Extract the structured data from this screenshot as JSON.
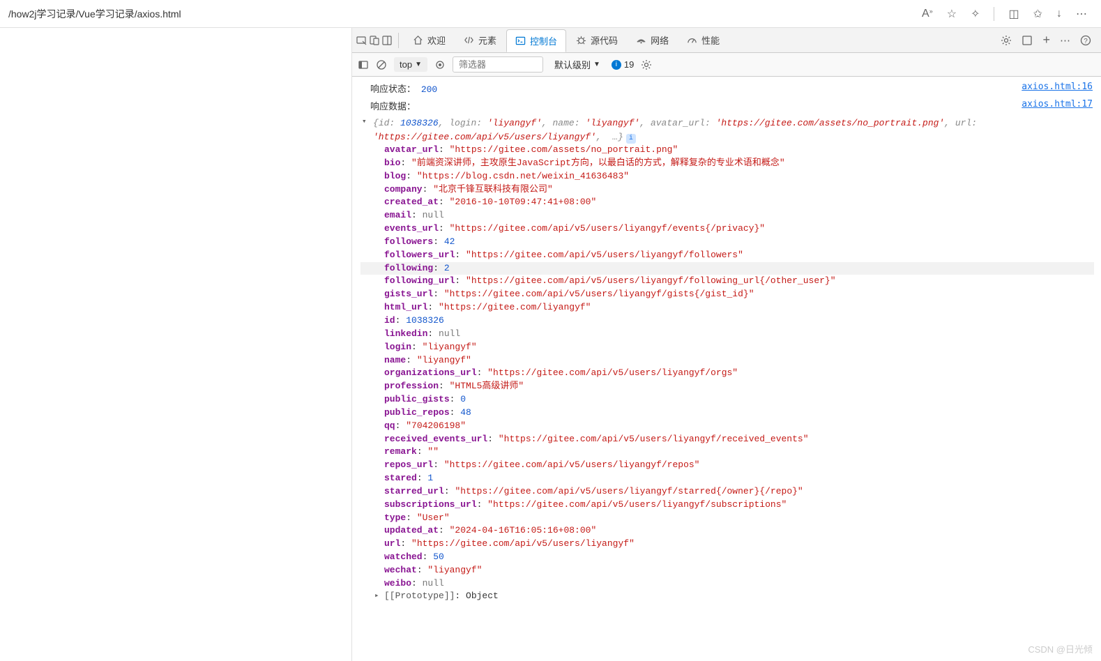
{
  "browser": {
    "url": "/how2j学习记录/Vue学习记录/axios.html"
  },
  "devtools": {
    "tabs": {
      "welcome": "欢迎",
      "elements": "元素",
      "console": "控制台",
      "sources": "源代码",
      "network": "网络",
      "performance": "性能"
    },
    "toolbar": {
      "context": "top",
      "filter_placeholder": "筛选器",
      "level": "默认级别",
      "issues_count": "19"
    }
  },
  "logs": {
    "status": {
      "label": "响应状态：",
      "value": "200",
      "src": "axios.html:16"
    },
    "data": {
      "label": "响应数据：",
      "src": "axios.html:17"
    },
    "summary": "{id: 1038326, login: 'liyangyf', name: 'liyangyf', avatar_url: 'https://gitee.com/assets/no_portrait.png', url: 'https://gitee.com/api/v5/users/liyangyf', …}",
    "summary_parts": {
      "id_k": "id:",
      "id_v": "1038326",
      "login_k": "login:",
      "login_v": "'liyangyf'",
      "name_k": "name:",
      "name_v": "'liyangyf'",
      "avatar_k": "avatar_url:",
      "avatar_v": "'https://gitee.com/assets/no_portrait.png'",
      "url_k": "url:",
      "url_v": "'https://gitee.com/api/v5/users/liyangyf'",
      "more": "…}"
    },
    "props": [
      {
        "key": "avatar_url",
        "type": "str",
        "val": "\"https://gitee.com/assets/no_portrait.png\""
      },
      {
        "key": "bio",
        "type": "str",
        "val": "\"前端资深讲师，主攻原生JavaScript方向，以最白话的方式，解释复杂的专业术语和概念\""
      },
      {
        "key": "blog",
        "type": "str",
        "val": "\"https://blog.csdn.net/weixin_41636483\""
      },
      {
        "key": "company",
        "type": "str",
        "val": "\"北京千锋互联科技有限公司\""
      },
      {
        "key": "created_at",
        "type": "str",
        "val": "\"2016-10-10T09:47:41+08:00\""
      },
      {
        "key": "email",
        "type": "null",
        "val": "null"
      },
      {
        "key": "events_url",
        "type": "str",
        "val": "\"https://gitee.com/api/v5/users/liyangyf/events{/privacy}\""
      },
      {
        "key": "followers",
        "type": "num",
        "val": "42"
      },
      {
        "key": "followers_url",
        "type": "str",
        "val": "\"https://gitee.com/api/v5/users/liyangyf/followers\""
      },
      {
        "key": "following",
        "type": "num",
        "val": "2",
        "highlight": true
      },
      {
        "key": "following_url",
        "type": "str",
        "val": "\"https://gitee.com/api/v5/users/liyangyf/following_url{/other_user}\""
      },
      {
        "key": "gists_url",
        "type": "str",
        "val": "\"https://gitee.com/api/v5/users/liyangyf/gists{/gist_id}\""
      },
      {
        "key": "html_url",
        "type": "str",
        "val": "\"https://gitee.com/liyangyf\""
      },
      {
        "key": "id",
        "type": "num",
        "val": "1038326"
      },
      {
        "key": "linkedin",
        "type": "null",
        "val": "null"
      },
      {
        "key": "login",
        "type": "str",
        "val": "\"liyangyf\""
      },
      {
        "key": "name",
        "type": "str",
        "val": "\"liyangyf\""
      },
      {
        "key": "organizations_url",
        "type": "str",
        "val": "\"https://gitee.com/api/v5/users/liyangyf/orgs\""
      },
      {
        "key": "profession",
        "type": "str",
        "val": "\"HTML5高级讲师\""
      },
      {
        "key": "public_gists",
        "type": "num",
        "val": "0"
      },
      {
        "key": "public_repos",
        "type": "num",
        "val": "48"
      },
      {
        "key": "qq",
        "type": "str",
        "val": "\"704206198\""
      },
      {
        "key": "received_events_url",
        "type": "str",
        "val": "\"https://gitee.com/api/v5/users/liyangyf/received_events\""
      },
      {
        "key": "remark",
        "type": "str",
        "val": "\"\""
      },
      {
        "key": "repos_url",
        "type": "str",
        "val": "\"https://gitee.com/api/v5/users/liyangyf/repos\""
      },
      {
        "key": "stared",
        "type": "num",
        "val": "1"
      },
      {
        "key": "starred_url",
        "type": "str",
        "val": "\"https://gitee.com/api/v5/users/liyangyf/starred{/owner}{/repo}\""
      },
      {
        "key": "subscriptions_url",
        "type": "str",
        "val": "\"https://gitee.com/api/v5/users/liyangyf/subscriptions\""
      },
      {
        "key": "type",
        "type": "str",
        "val": "\"User\""
      },
      {
        "key": "updated_at",
        "type": "str",
        "val": "\"2024-04-16T16:05:16+08:00\""
      },
      {
        "key": "url",
        "type": "str",
        "val": "\"https://gitee.com/api/v5/users/liyangyf\""
      },
      {
        "key": "watched",
        "type": "num",
        "val": "50"
      },
      {
        "key": "wechat",
        "type": "str",
        "val": "\"liyangyf\""
      },
      {
        "key": "weibo",
        "type": "null",
        "val": "null"
      }
    ],
    "proto": {
      "key": "[[Prototype]]",
      "val": "Object"
    }
  },
  "watermark": "CSDN @日光倾"
}
